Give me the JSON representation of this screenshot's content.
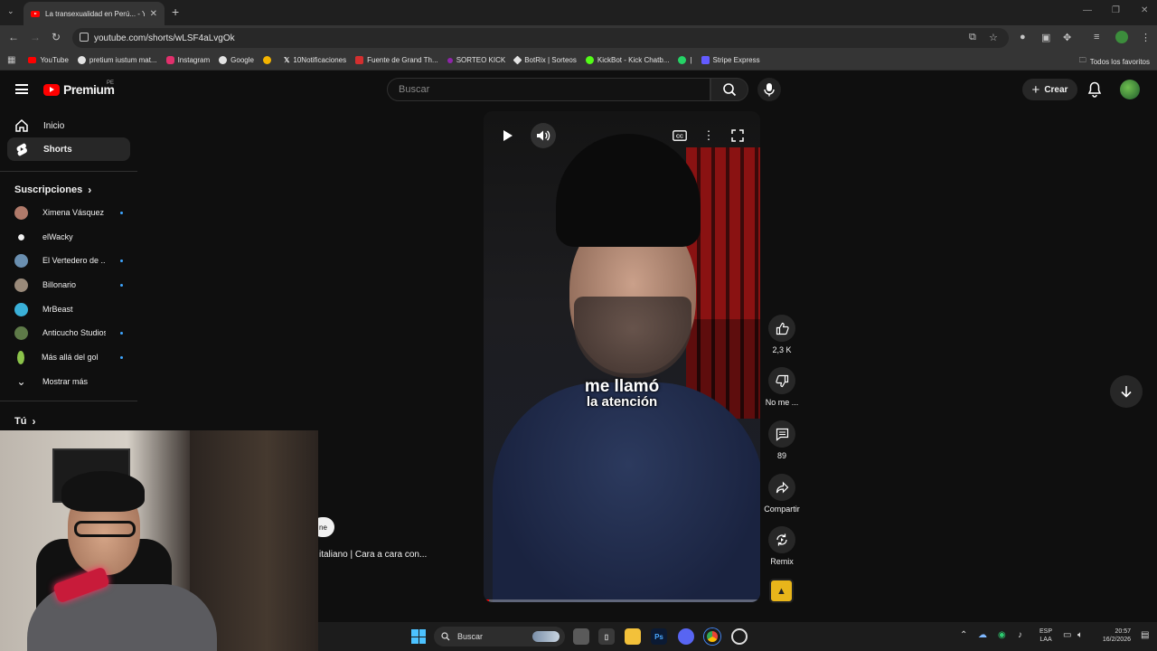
{
  "browser": {
    "tab_title": "La transexualidad en Perú... - Yo",
    "url": "youtube.com/shorts/wLSF4aLvgOk",
    "bookmarks": [
      {
        "label": "YouTube",
        "color": "#ff0000"
      },
      {
        "label": "pretium iustum mat...",
        "color": "#e3e3e3"
      },
      {
        "label": "Instagram",
        "color": "#e1306c"
      },
      {
        "label": "Google",
        "color": "#e3e3e3"
      },
      {
        "label": "",
        "color": "#f4b400"
      },
      {
        "label": "10Notificaciones",
        "color": "#000000"
      },
      {
        "label": "Fuente de Grand Th...",
        "color": "#d32f2f"
      },
      {
        "label": "SORTEO KICK",
        "color": "#8e24aa"
      },
      {
        "label": "BotRix | Sorteos",
        "color": "#e3e3e3"
      },
      {
        "label": "KickBot - Kick Chatb...",
        "color": "#53fc18"
      },
      {
        "label": "|",
        "color": "#25d366"
      },
      {
        "label": "Stripe Express",
        "color": "#635bff"
      }
    ],
    "all_bookmarks": "Todos los favoritos"
  },
  "header": {
    "logo_text": "Premium",
    "country_code": "PE",
    "search_placeholder": "Buscar",
    "create_label": "Crear"
  },
  "sidebar": {
    "nav": [
      {
        "label": "Inicio"
      },
      {
        "label": "Shorts"
      }
    ],
    "subscriptions_title": "Suscripciones",
    "subscriptions": [
      {
        "name": "Ximena Vásquez",
        "color": "#b07a6a",
        "new": true
      },
      {
        "name": "elWacky",
        "color": "#f1f1f1",
        "new": false
      },
      {
        "name": "El Vertedero de ...",
        "color": "#6a8fb0",
        "new": true
      },
      {
        "name": "Billonario",
        "color": "#9a8a7a",
        "new": true
      },
      {
        "name": "MrBeast",
        "color": "#3ab0d8",
        "new": false
      },
      {
        "name": "Anticucho Studios",
        "color": "#5e7a48",
        "new": true
      },
      {
        "name": "Más allá del gol",
        "color": "#8bc34a",
        "new": true
      }
    ],
    "show_more": "Mostrar más",
    "you_title": "Tú"
  },
  "short": {
    "caption_line1": "me llamó",
    "caption_line2": "la atención",
    "progress": 0.02,
    "actions": {
      "likes": "2,3 K",
      "dislike": "No me ...",
      "comments": "89",
      "share": "Compartir",
      "remix": "Remix"
    }
  },
  "previous_short": {
    "pill": "ne",
    "title": "italiano | Cara a cara con..."
  },
  "taskbar": {
    "search": "Buscar",
    "lang1": "ESP",
    "lang2": "LAA",
    "time": "20:57",
    "date": "16/2/2026"
  }
}
